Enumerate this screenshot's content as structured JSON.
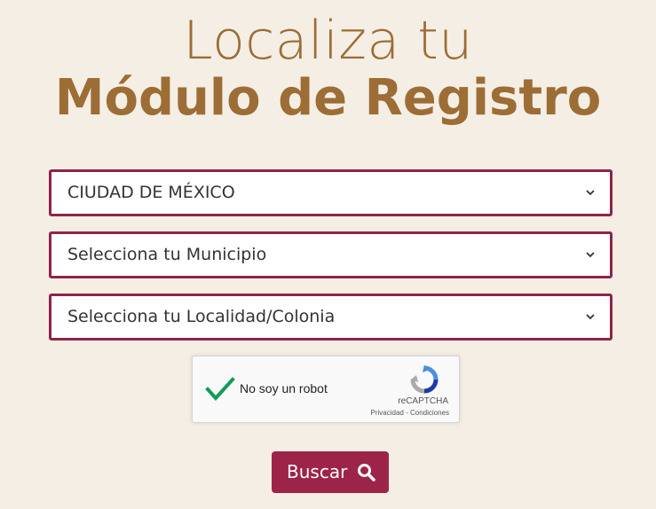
{
  "header": {
    "title_line1": "Localiza tu",
    "title_line2": "Módulo de Registro"
  },
  "form": {
    "state_select": {
      "value": "CIUDAD DE MÉXICO",
      "icon": "chevron-down-icon"
    },
    "municipio_select": {
      "value": "Selecciona tu Municipio",
      "icon": "chevron-down-icon"
    },
    "localidad_select": {
      "value": "Selecciona tu Localidad/Colonia",
      "icon": "chevron-down-icon"
    }
  },
  "captcha": {
    "checked": true,
    "label": "No soy un robot",
    "brand": "reCAPTCHA",
    "privacy": "Privacidad",
    "separator": " - ",
    "terms": "Condiciones"
  },
  "search_button": {
    "label": "Buscar",
    "icon": "search-icon"
  },
  "colors": {
    "background": "#f5eee4",
    "title": "#9c6d35",
    "border": "#8e2448",
    "button": "#9d2449",
    "check": "#0f9d58"
  }
}
